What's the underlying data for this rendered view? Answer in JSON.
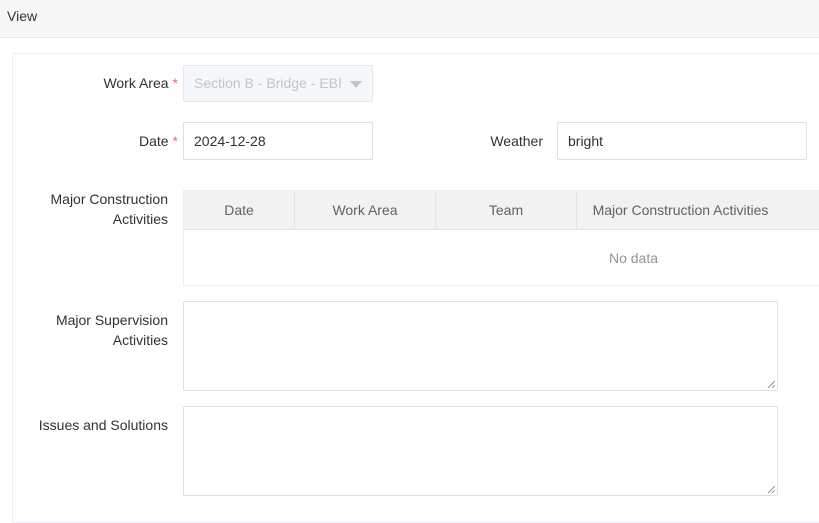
{
  "header": {
    "title": "View"
  },
  "form": {
    "work_area": {
      "label": "Work Area",
      "required_mark": "*",
      "value": "Section B - Bridge - EBI"
    },
    "date": {
      "label": "Date",
      "required_mark": "*",
      "value": "2024-12-28"
    },
    "weather": {
      "label": "Weather",
      "value": "bright"
    },
    "major_construction": {
      "label_line1": "Major Construction",
      "label_line2": "Activities",
      "columns": [
        "Date",
        "Work Area",
        "Team",
        "Major Construction Activities"
      ],
      "empty_text": "No data"
    },
    "major_supervision": {
      "label_line1": "Major Supervision",
      "label_line2": "Activities",
      "value": ""
    },
    "issues": {
      "label": "Issues and Solutions",
      "value": ""
    }
  },
  "colors": {
    "required": "#f56c6c",
    "border": "#dcdfe6",
    "header_bg": "#f2f2f2"
  }
}
